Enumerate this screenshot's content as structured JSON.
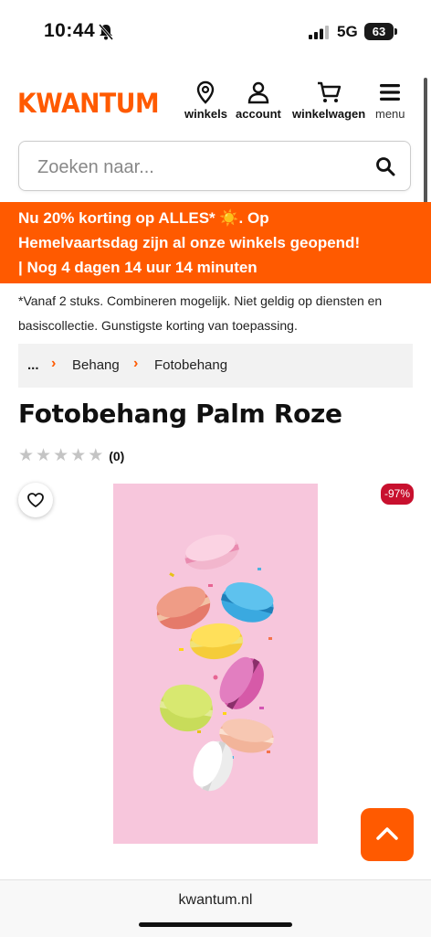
{
  "status": {
    "time": "10:44",
    "network": "5G",
    "battery": "63"
  },
  "header": {
    "logo": "KWANTUM",
    "nav": {
      "stores": "winkels",
      "account": "account",
      "cart": "winkelwagen",
      "menu": "menu"
    }
  },
  "search": {
    "placeholder": "Zoeken naar..."
  },
  "promo": {
    "line1": "Nu 20% korting op ALLES* ☀️. Op",
    "line2": "Hemelvaartsdag zijn al onze winkels geopend!",
    "line3": "|  Nog 4 dagen 14 uur 14 minuten"
  },
  "disclaimer": "*Vanaf 2 stuks. Combineren mogelijk. Niet geldig op diensten en basiscollectie. Gunstigste korting van toepassing.",
  "breadcrumb": {
    "ellipsis": "...",
    "items": [
      "Behang",
      "Fotobehang"
    ]
  },
  "product": {
    "title": "Fotobehang Palm Roze",
    "rating": 0,
    "review_count": "(0)",
    "discount_badge": "-97%"
  },
  "browser": {
    "url": "kwantum.nl"
  },
  "colors": {
    "brand": "#ff5a00",
    "badge": "#c8102e",
    "image_bg": "#f7c6dc"
  }
}
